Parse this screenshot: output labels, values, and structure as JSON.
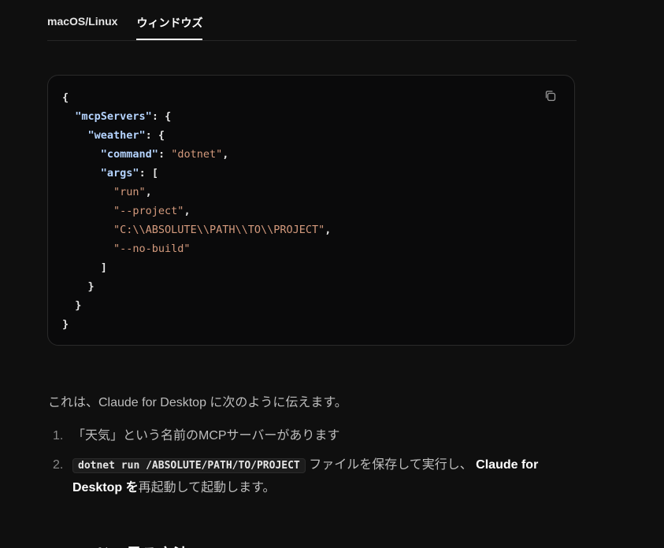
{
  "tabs": [
    {
      "label": "macOS/Linux",
      "active": false
    },
    {
      "label": "ウィンドウズ",
      "active": true
    }
  ],
  "code_block": {
    "copy_icon": "copy-icon",
    "key_mcpServers": "\"mcpServers\"",
    "key_weather": "\"weather\"",
    "key_command": "\"command\"",
    "val_command": "\"dotnet\"",
    "key_args": "\"args\"",
    "arg1": "\"run\"",
    "arg2": "\"--project\"",
    "arg3": "\"C:\\\\ABSOLUTE\\\\PATH\\\\TO\\\\PROJECT\"",
    "arg4": "\"--no-build\""
  },
  "intro": "これは、Claude for Desktop に次のように伝えます。",
  "list": [
    {
      "num": "1.",
      "text": "「天気」という名前のMCPサーバーがあります"
    },
    {
      "num": "2.",
      "code": "dotnet run /ABSOLUTE/PATH/TO/PROJECT",
      "text_mid": " ファイルを保存して実行し、",
      "strong": " Claude for Desktop を",
      "text_end": "再起動して起動します。"
    }
  ],
  "next_heading": "コマンドで見る方法"
}
